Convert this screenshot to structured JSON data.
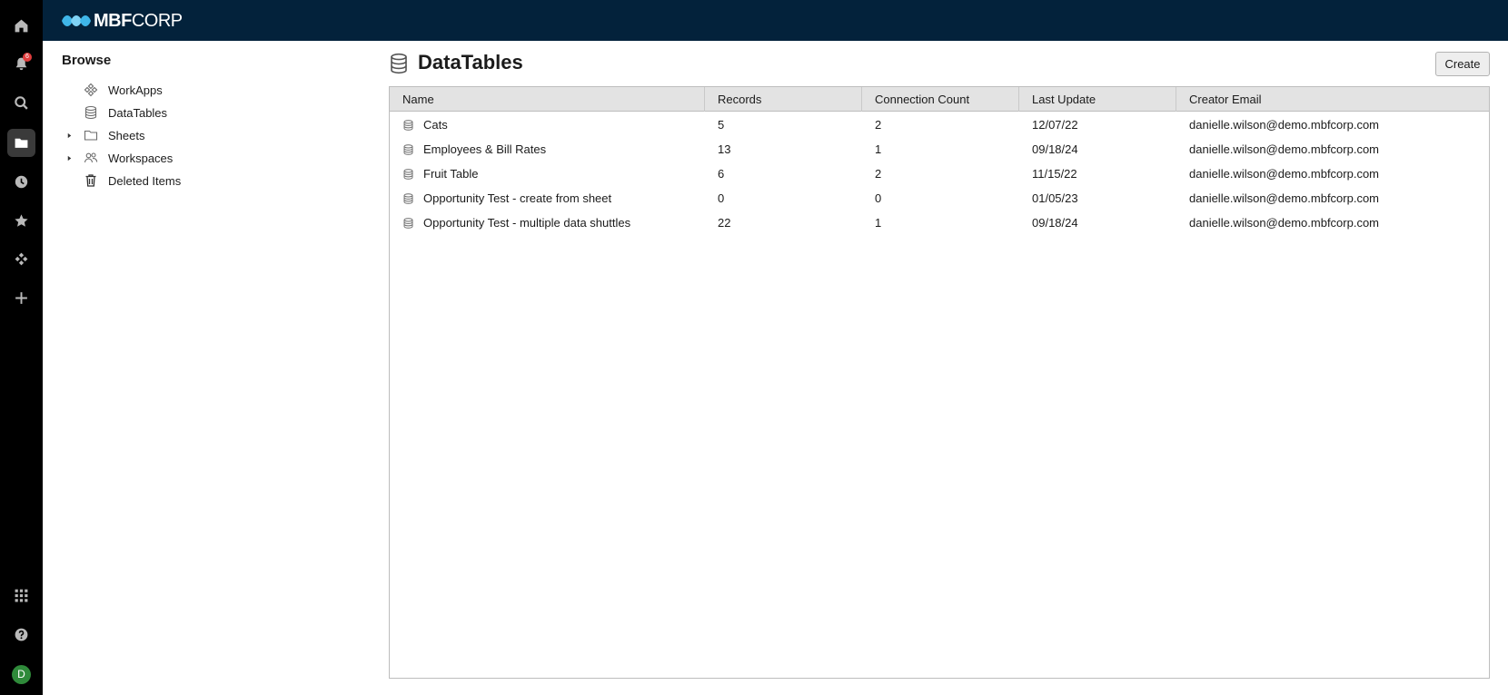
{
  "app": {
    "brand_bold": "MBF",
    "brand_thin": "CORP",
    "notification_count": "6",
    "avatar_initial": "D"
  },
  "rail": [
    {
      "name": "home-icon"
    },
    {
      "name": "bell-icon"
    },
    {
      "name": "search-icon"
    },
    {
      "name": "folder-icon"
    },
    {
      "name": "clock-icon"
    },
    {
      "name": "star-icon"
    },
    {
      "name": "workapps-icon"
    },
    {
      "name": "plus-icon"
    },
    {
      "name": "apps-grid-icon"
    },
    {
      "name": "help-icon"
    }
  ],
  "browse": {
    "title": "Browse",
    "items": [
      {
        "label": "WorkApps",
        "icon": "workapps-icon",
        "expandable": false
      },
      {
        "label": "DataTables",
        "icon": "database-icon",
        "expandable": false
      },
      {
        "label": "Sheets",
        "icon": "folder-icon",
        "expandable": true
      },
      {
        "label": "Workspaces",
        "icon": "people-icon",
        "expandable": true
      },
      {
        "label": "Deleted Items",
        "icon": "trash-icon",
        "expandable": false
      }
    ]
  },
  "main": {
    "title": "DataTables",
    "create_label": "Create",
    "columns": [
      "Name",
      "Records",
      "Connection Count",
      "Last Update",
      "Creator Email"
    ],
    "rows": [
      {
        "name": "Cats",
        "records": "5",
        "connections": "2",
        "updated": "12/07/22",
        "email": "danielle.wilson@demo.mbfcorp.com"
      },
      {
        "name": "Employees & Bill Rates",
        "records": "13",
        "connections": "1",
        "updated": "09/18/24",
        "email": "danielle.wilson@demo.mbfcorp.com"
      },
      {
        "name": "Fruit Table",
        "records": "6",
        "connections": "2",
        "updated": "11/15/22",
        "email": "danielle.wilson@demo.mbfcorp.com"
      },
      {
        "name": "Opportunity Test - create from sheet",
        "records": "0",
        "connections": "0",
        "updated": "01/05/23",
        "email": "danielle.wilson@demo.mbfcorp.com"
      },
      {
        "name": "Opportunity Test - multiple data shuttles",
        "records": "22",
        "connections": "1",
        "updated": "09/18/24",
        "email": "danielle.wilson@demo.mbfcorp.com"
      }
    ]
  },
  "colors": {
    "topbar": "#03223b",
    "rail": "#000000",
    "badge": "#e03d3d",
    "avatar": "#2f8a3a",
    "logo_accent": "#3fb6e8"
  }
}
